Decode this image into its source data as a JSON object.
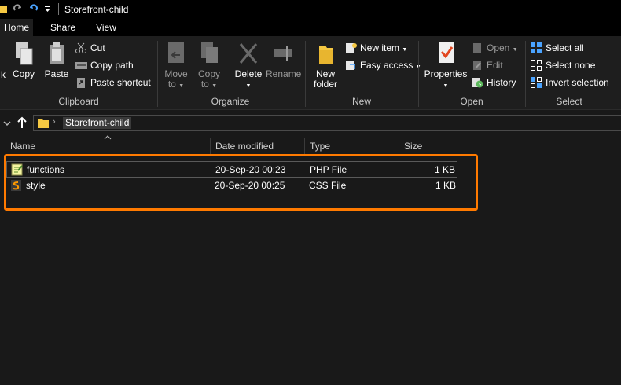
{
  "window": {
    "title": "Storefront-child"
  },
  "tabs": [
    {
      "label": "Home",
      "active": true
    },
    {
      "label": "Share",
      "active": false
    },
    {
      "label": "View",
      "active": false
    }
  ],
  "ribbon": {
    "clipboard": {
      "label": "Clipboard",
      "pin_label": "k",
      "copy": "Copy",
      "paste": "Paste",
      "cut": "Cut",
      "copy_path": "Copy path",
      "paste_shortcut": "Paste shortcut"
    },
    "organize": {
      "label": "Organize",
      "move_to_line1": "Move",
      "move_to_line2": "to",
      "copy_to_line1": "Copy",
      "copy_to_line2": "to",
      "delete": "Delete",
      "rename": "Rename"
    },
    "new": {
      "label": "New",
      "new_folder_line1": "New",
      "new_folder_line2": "folder",
      "new_item": "New item",
      "easy_access": "Easy access"
    },
    "open": {
      "label": "Open",
      "properties": "Properties",
      "open": "Open",
      "edit": "Edit",
      "history": "History"
    },
    "select": {
      "label": "Select",
      "select_all": "Select all",
      "select_none": "Select none",
      "invert_selection": "Invert selection"
    }
  },
  "address": {
    "path_separator": "›",
    "current": "Storefront-child"
  },
  "columns": {
    "name": "Name",
    "date": "Date modified",
    "type": "Type",
    "size": "Size"
  },
  "files": [
    {
      "name": "functions",
      "date": "20-Sep-20 00:23",
      "type": "PHP File",
      "size": "1 KB",
      "icon": "php-file-icon"
    },
    {
      "name": "style",
      "date": "20-Sep-20 00:25",
      "type": "CSS File",
      "size": "1 KB",
      "icon": "css-file-icon"
    }
  ],
  "colors": {
    "highlight": "#ff7a00",
    "folder": "#f5c842",
    "accent": "#4aa3ff"
  }
}
